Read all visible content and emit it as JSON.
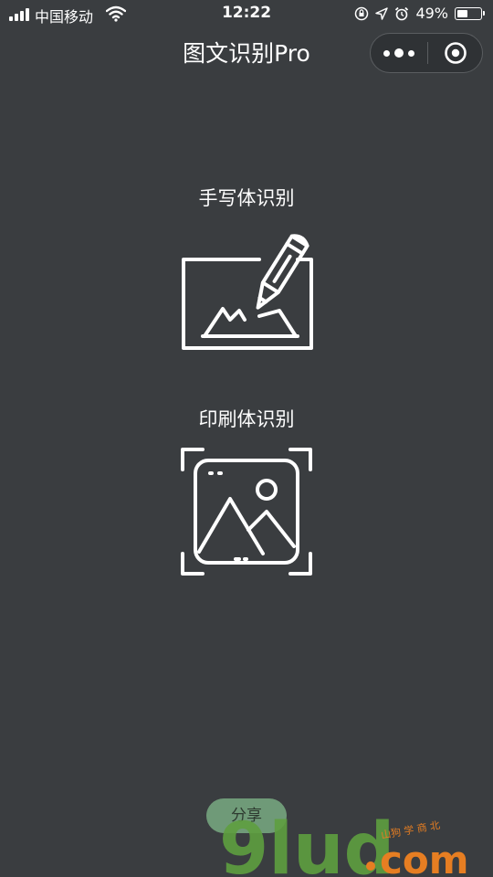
{
  "status_bar": {
    "carrier": "中国移动",
    "time": "12:22",
    "battery_text": "49%",
    "battery_level": 0.49,
    "icons": [
      "signal-icon",
      "wifi-icon",
      "rotation-lock-icon",
      "location-icon",
      "alarm-icon",
      "battery-icon"
    ]
  },
  "nav": {
    "title": "图文识别Pro",
    "capsule": {
      "icons": [
        "more-dots-icon",
        "close-miniprogram-icon"
      ]
    }
  },
  "features": [
    {
      "label": "手写体识别",
      "icon": "handwriting-pencil-icon"
    },
    {
      "label": "印刷体识别",
      "icon": "image-scan-icon"
    }
  ],
  "share": {
    "label": "分享"
  },
  "watermark": {
    "logo": "9lud.com",
    "colors": {
      "green": "#6ab04c",
      "orange": "#e67e22"
    }
  },
  "colors": {
    "background": "#3a3d40",
    "foreground": "#ffffff",
    "share_button": "#6f9a78"
  }
}
